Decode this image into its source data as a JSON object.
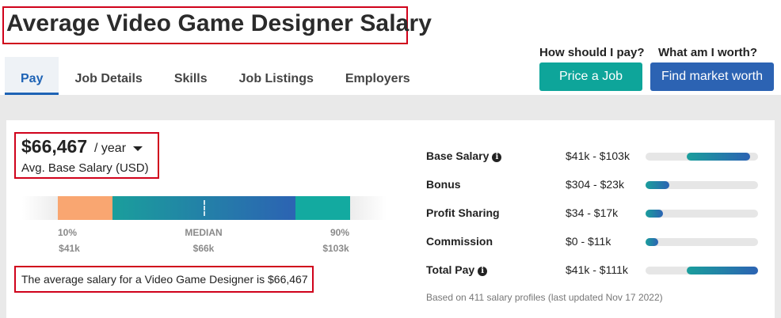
{
  "page": {
    "title": "Average Video Game Designer Salary"
  },
  "tabs": [
    {
      "label": "Pay",
      "active": true
    },
    {
      "label": "Job Details"
    },
    {
      "label": "Skills"
    },
    {
      "label": "Job Listings"
    },
    {
      "label": "Employers"
    }
  ],
  "cta": {
    "price": {
      "question": "How should I pay?",
      "label": "Price a Job",
      "color": "#0ea59a"
    },
    "market": {
      "question": "What am I worth?",
      "label": "Find market worth",
      "color": "#2c63b3"
    }
  },
  "summary": {
    "amount": "$66,467",
    "period": "/ year",
    "caption": "Avg. Base Salary (USD)",
    "statement": "The average salary for a Video Game Designer is $66,467"
  },
  "distribution": {
    "low": {
      "pct": "10%",
      "value": "$41k"
    },
    "median": {
      "pct": "MEDIAN",
      "value": "$66k"
    },
    "high": {
      "pct": "90%",
      "value": "$103k"
    },
    "colors": {
      "low": "#f9a671",
      "mid_start": "#1a9e9c",
      "mid_end": "#2c63b3",
      "high": "#13aaa0"
    }
  },
  "breakdown": [
    {
      "label": "Base Salary",
      "info": true,
      "range": "$41k - $103k",
      "min": 41000,
      "max": 103000
    },
    {
      "label": "Bonus",
      "info": false,
      "range": "$304 - $23k",
      "min": 304,
      "max": 23000
    },
    {
      "label": "Profit Sharing",
      "info": false,
      "range": "$34 - $17k",
      "min": 34,
      "max": 17000
    },
    {
      "label": "Commission",
      "info": false,
      "range": "$0 - $11k",
      "min": 0,
      "max": 11000
    },
    {
      "label": "Total Pay",
      "info": true,
      "range": "$41k - $111k",
      "min": 41000,
      "max": 111000
    }
  ],
  "footnote": "Based on 411 salary profiles (last updated Nov 17 2022)"
}
